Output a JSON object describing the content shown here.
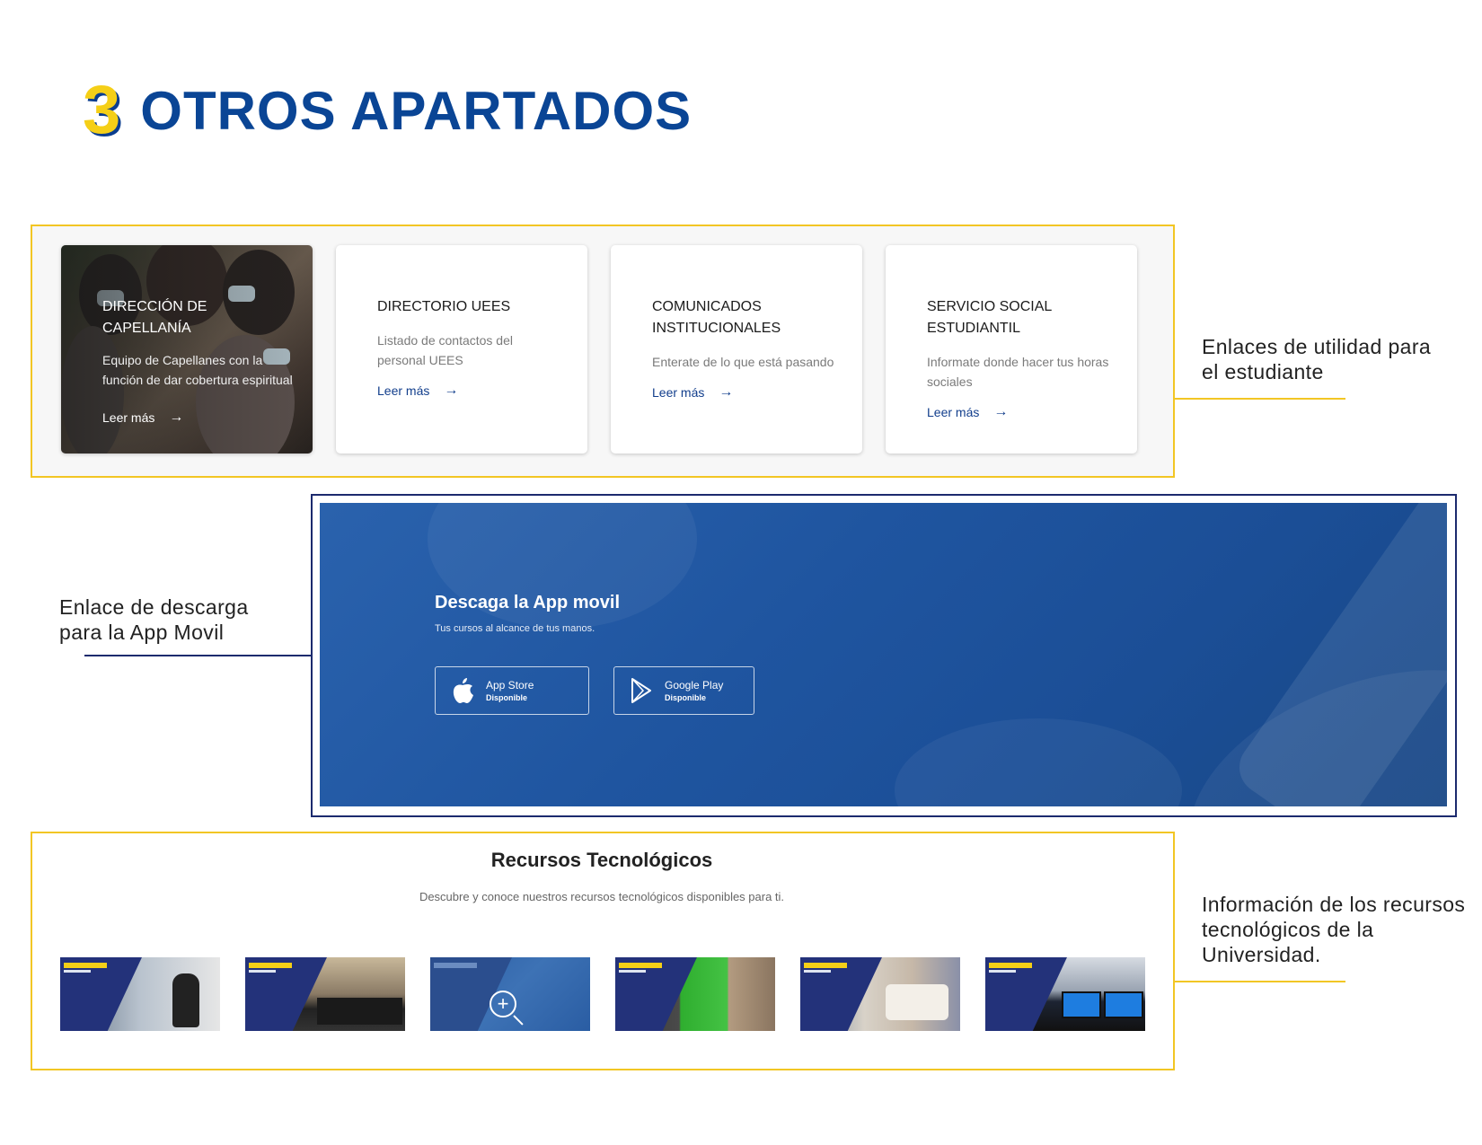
{
  "heading": {
    "number": "3",
    "title": "OTROS APARTADOS"
  },
  "annotations": {
    "links": "Enlaces de utilidad para el estudiante",
    "app": "Enlace de descarga para la App Movil",
    "resources": "Información de los recursos tecnológicos de la Universidad."
  },
  "colors": {
    "yellow": "#f2c624",
    "navy": "#1c2a6e",
    "brand_blue": "#0a4595"
  },
  "cards": [
    {
      "title": "DIRECCIÓN DE CAPELLANÍA",
      "desc": "Equipo de Capellanes con la función de dar cobertura espiritual",
      "link": "Leer más"
    },
    {
      "title": "DIRECTORIO UEES",
      "desc": "Listado de contactos del personal UEES",
      "link": "Leer más"
    },
    {
      "title": "COMUNICADOS INSTITUCIONALES",
      "desc": "Enterate de lo que está pasando",
      "link": "Leer más"
    },
    {
      "title": "SERVICIO SOCIAL ESTUDIANTIL",
      "desc": "Informate donde hacer tus horas sociales",
      "link": "Leer más"
    }
  ],
  "app_banner": {
    "title": "Descaga la App movil",
    "subtitle": "Tus cursos al alcance de tus manos.",
    "buttons": [
      {
        "name": "App Store",
        "availability": "Disponible",
        "icon": "apple-icon"
      },
      {
        "name": "Google Play",
        "availability": "Disponible",
        "icon": "play-icon"
      }
    ]
  },
  "resources": {
    "title": "Recursos Tecnológicos",
    "subtitle": "Descubre y conoce nuestros recursos tecnológicos disponibles para ti.",
    "thumbnails": [
      "biblioteca-virtual",
      "laboratorio",
      "estudio",
      "estudio-fotografico",
      "laboratorio-practicas",
      "tecnolabs"
    ]
  }
}
